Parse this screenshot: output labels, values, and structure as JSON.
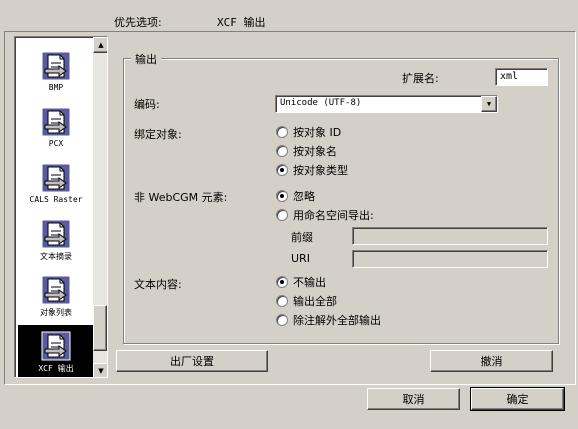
{
  "header": {
    "title": "优先选项:",
    "subtitle": "XCF 输出"
  },
  "sidebar": {
    "items": [
      {
        "label": "BMP",
        "selected": false,
        "icon": "document-arrow-icon"
      },
      {
        "label": "PCX",
        "selected": false,
        "icon": "document-arrow-icon"
      },
      {
        "label": "CALS Raster",
        "selected": false,
        "icon": "document-arrow-icon"
      },
      {
        "label": "文本摘录",
        "selected": false,
        "icon": "document-arrow-icon"
      },
      {
        "label": "对象列表",
        "selected": false,
        "icon": "document-arrow-icon"
      },
      {
        "label": "XCF 输出",
        "selected": true,
        "icon": "document-arrow-icon"
      }
    ]
  },
  "group": {
    "title": "输出",
    "extension_label": "扩展名:",
    "extension_value": "xml",
    "encoding_label": "编码:",
    "encoding_value": "Unicode (UTF-8)",
    "bind_label": "绑定对象:",
    "bind_options": [
      {
        "label": "按对象 ID",
        "checked": false
      },
      {
        "label": "按对象名",
        "checked": false
      },
      {
        "label": "按对象类型",
        "checked": true
      }
    ],
    "nonweb_label": "非 WebCGM 元素:",
    "nonweb_options": [
      {
        "label": "忽略",
        "checked": true
      },
      {
        "label": "用命名空间导出:",
        "checked": false
      }
    ],
    "prefix_label": "前缀",
    "prefix_value": "",
    "uri_label": "URI",
    "uri_value": "",
    "text_label": "文本内容:",
    "text_options": [
      {
        "label": "不输出",
        "checked": true
      },
      {
        "label": "输出全部",
        "checked": false
      },
      {
        "label": "除注解外全部输出",
        "checked": false
      }
    ]
  },
  "buttons": {
    "factory": "出厂设置",
    "undo": "撤消",
    "cancel": "取消",
    "ok": "确定"
  }
}
